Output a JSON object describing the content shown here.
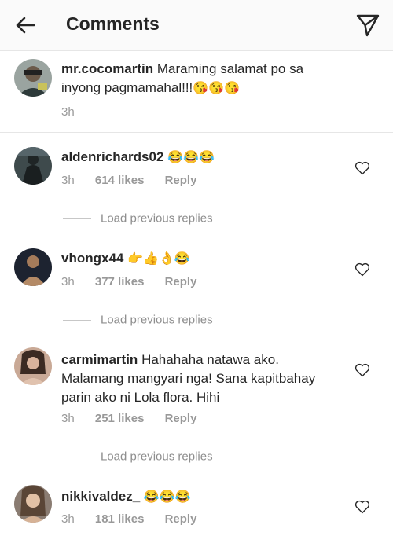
{
  "header": {
    "title": "Comments",
    "back_icon": "back-arrow-icon",
    "send_icon": "paper-plane-icon"
  },
  "caption": {
    "username": "mr.cocomartin",
    "text": "Maraming salamat po sa inyong pagmamahal!!!",
    "emojis": "😘😘😘",
    "time": "3h"
  },
  "comments": [
    {
      "username": "aldenrichards02",
      "text": "",
      "emojis": "😂😂😂",
      "time": "3h",
      "likes": "614 likes",
      "reply": "Reply",
      "load_replies": "Load previous replies"
    },
    {
      "username": "vhongx44",
      "text": "",
      "emojis": "👉👍👌😂",
      "time": "3h",
      "likes": "377 likes",
      "reply": "Reply",
      "load_replies": "Load previous replies"
    },
    {
      "username": "carmimartin",
      "text": "Hahahaha natawa ako. Malamang mangyari nga! Sana kapitbahay parin ako ni Lola flora. Hihi",
      "emojis": "",
      "time": "3h",
      "likes": "251 likes",
      "reply": "Reply",
      "load_replies": "Load previous replies"
    },
    {
      "username": "nikkivaldez_",
      "text": "",
      "emojis": "😂😂😂",
      "time": "3h",
      "likes": "181 likes",
      "reply": "Reply"
    }
  ]
}
